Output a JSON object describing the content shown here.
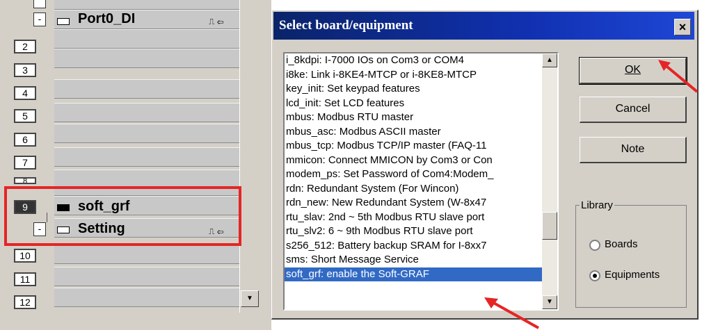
{
  "left_panel": {
    "rows": [
      {
        "num": "2"
      },
      {
        "num": "3"
      },
      {
        "num": "4"
      },
      {
        "num": "5"
      },
      {
        "num": "6"
      },
      {
        "num": "7"
      },
      {
        "num": "8"
      },
      {
        "num": "9"
      },
      {
        "num": "10"
      },
      {
        "num": "11"
      },
      {
        "num": "12"
      }
    ],
    "minus": "-",
    "port_label": "Port0_DI",
    "soft_grf_label": "soft_grf",
    "setting_label": "Setting",
    "pin_glyph": "⎍ ⇦"
  },
  "dialog": {
    "title": "Select board/equipment",
    "close": "×",
    "list_items": [
      "i_8kdpi: I-7000 IOs on Com3 or COM4",
      "i8ke: Link i-8KE4-MTCP or i-8KE8-MTCP",
      "key_init: Set keypad features",
      "lcd_init: Set LCD features",
      "mbus: Modbus RTU master",
      "mbus_asc: Modbus ASCII master",
      "mbus_tcp: Modbus TCP/IP master (FAQ-11",
      "mmicon: Connect MMICON by Com3 or Con",
      "modem_ps: Set Password of Com4:Modem_",
      "rdn: Redundant System (For Wincon)",
      "rdn_new: New Redundant System (W-8x47",
      "rtu_slav: 2nd ~ 5th Modbus RTU slave port",
      "rtu_slv2: 6 ~ 9th Modbus RTU slave port",
      "s256_512: Battery backup SRAM for I-8xx7",
      "sms: Short Message Service",
      "soft_grf: enable the Soft-GRAF"
    ],
    "selected_index": 15,
    "ok_label": "OK",
    "cancel_label": "Cancel",
    "note_label": "Note",
    "library_label": "Library",
    "boards_label": "Boards",
    "equipments_label": "Equipments",
    "library_selected": "Equipments"
  },
  "colors": {
    "titlebar": "#0a246a",
    "selection": "#316ac5",
    "highlight_box": "#e52525"
  }
}
